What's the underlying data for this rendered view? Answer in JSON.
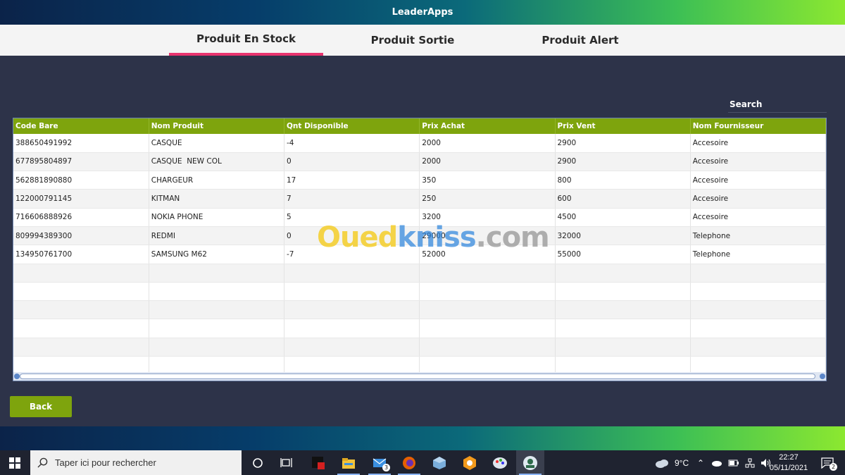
{
  "app": {
    "title": "LeaderApps"
  },
  "tabs": [
    {
      "label": "Produit En Stock",
      "active": true
    },
    {
      "label": "Produit Sortie",
      "active": false
    },
    {
      "label": "Produit Alert",
      "active": false
    }
  ],
  "search": {
    "placeholder": "Search"
  },
  "table": {
    "columns": [
      "Code Bare",
      "Nom Produit",
      "Qnt Disponible",
      "Prix Achat",
      "Prix Vent",
      "Nom Fournisseur"
    ],
    "rows": [
      [
        "388650491992",
        "CASQUE",
        "-4",
        "2000",
        "2900",
        "Accesoire"
      ],
      [
        "677895804897",
        "CASQUE  NEW COL",
        "0",
        "2000",
        "2900",
        "Accesoire"
      ],
      [
        "562881890880",
        "CHARGEUR",
        "17",
        "350",
        "800",
        "Accesoire"
      ],
      [
        "122000791145",
        "KITMAN",
        "7",
        "250",
        "600",
        "Accesoire"
      ],
      [
        "716606888926",
        "NOKIA PHONE",
        "5",
        "3200",
        "4500",
        "Accesoire"
      ],
      [
        "809994389300",
        "REDMI",
        "0",
        "29000",
        "32000",
        "Telephone"
      ],
      [
        "134950761700",
        "SAMSUNG M62",
        "-7",
        "52000",
        "55000",
        "Telephone"
      ]
    ],
    "empty_rows": 6
  },
  "watermark": {
    "part1": "Oued",
    "part2": "kniss",
    "part3": ".com"
  },
  "back_button": {
    "label": "Back"
  },
  "taskbar": {
    "search_placeholder": "Taper ici pour rechercher",
    "mail_badge": "3",
    "temperature": "9°C",
    "time": "22:27",
    "date": "05/11/2021",
    "notification_count": "2"
  },
  "colors": {
    "accent_green": "#7ea40d",
    "tab_underline": "#e8336e",
    "background": "#2d3349"
  }
}
